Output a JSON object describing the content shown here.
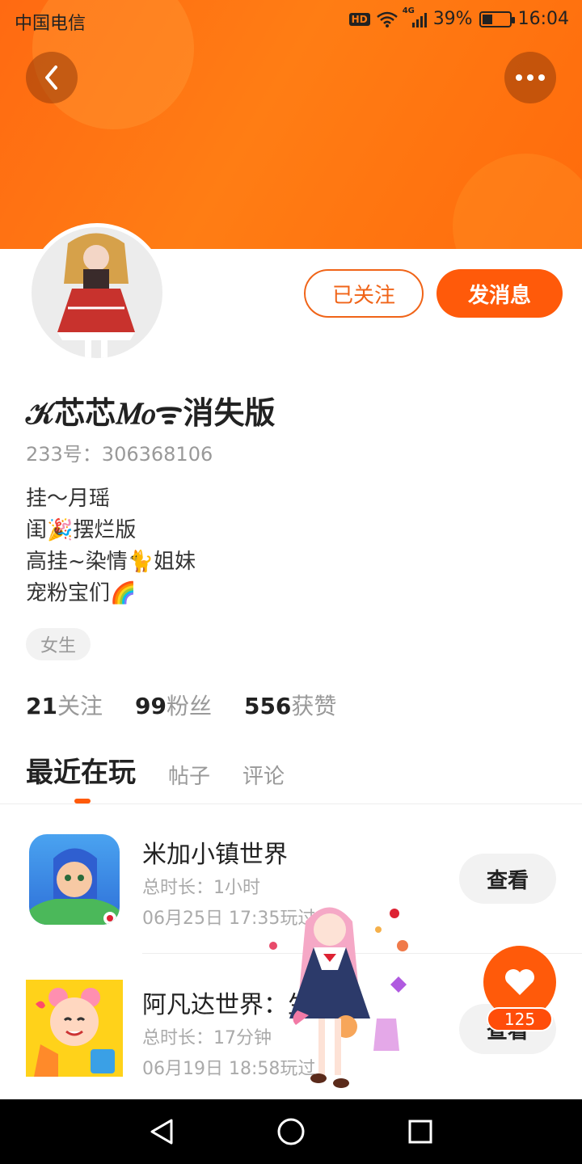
{
  "status_bar": {
    "carrier": "中国电信",
    "hd": "HD",
    "network": "4G",
    "battery": "39%",
    "battery_level": 0.39,
    "time": "16:04"
  },
  "header": {
    "back_icon": "chevron-left-icon",
    "more_icon": "more-dots-icon",
    "banner_color": "#ff7614"
  },
  "profile": {
    "followed_label": "已关注",
    "message_label": "发消息",
    "nickname": "𝒦芯芯𝑀𝑜ᯤ消失版",
    "uid": "233号：306368106",
    "bio": [
      "挂～月瑶",
      "闺🎉摆烂版",
      "高挂~染情🐈姐妹",
      "宠粉宝们🌈"
    ],
    "gender": "女生",
    "stats": [
      {
        "num": "21",
        "label": "关注"
      },
      {
        "num": "99",
        "label": "粉丝"
      },
      {
        "num": "556",
        "label": "获赞"
      }
    ]
  },
  "tabs": [
    {
      "label": "最近在玩",
      "active": true
    },
    {
      "label": "帖子",
      "active": false
    },
    {
      "label": "评论",
      "active": false
    }
  ],
  "games": [
    {
      "title": "米加小镇世界",
      "duration": "总时长：1小时",
      "played": "06月25日 17:35玩过",
      "button": "查看"
    },
    {
      "title": "阿凡达世界：生活",
      "duration": "总时长：17分钟",
      "played": "06月19日 18:58玩过",
      "button": "查看"
    }
  ],
  "floating_like": {
    "count": "125"
  },
  "accent_color": "#ff5a0a"
}
